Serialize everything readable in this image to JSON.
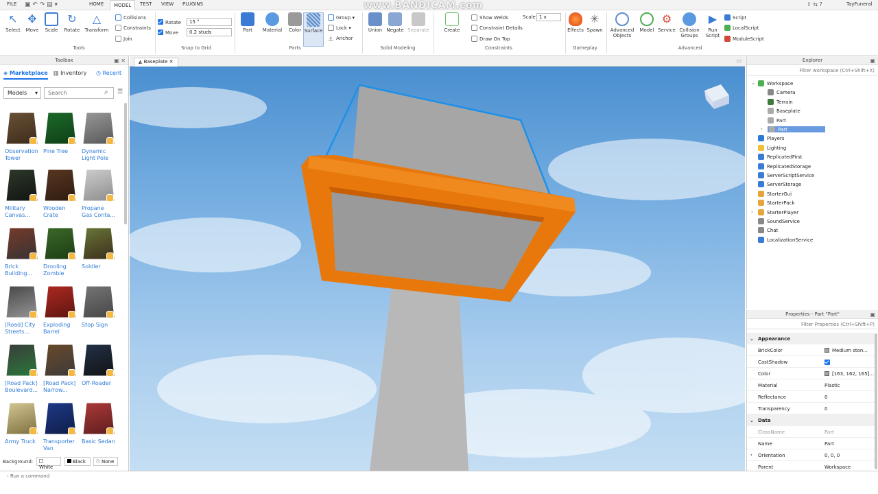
{
  "menubar": {
    "file": "FILE",
    "home": "HOME",
    "model": "MODEL",
    "test": "TEST",
    "view": "VIEW",
    "plugins": "PLUGINS",
    "user": "TayFuneral"
  },
  "watermark": "www.BANDICAM.com",
  "tools": {
    "select": "Select",
    "move": "Move",
    "scale": "Scale",
    "rotate": "Rotate",
    "transform": "Transform",
    "group_label": "Tools",
    "collisions": "Collisions",
    "constraints": "Constraints",
    "join": "Join"
  },
  "snap": {
    "rotate_label": "Rotate",
    "rotate_value": "15 °",
    "move_label": "Move",
    "move_value": "0.2 studs",
    "group_label": "Snap to Grid"
  },
  "parts": {
    "part": "Part",
    "material": "Material",
    "color": "Color",
    "surface": "Surface",
    "group": "Group",
    "lock": "Lock",
    "anchor": "Anchor",
    "group_label": "Parts"
  },
  "solid": {
    "union": "Union",
    "negate": "Negate",
    "separate": "Separate",
    "group_label": "Solid Modeling"
  },
  "constraints": {
    "create": "Create",
    "show_welds": "Show Welds",
    "constraint_details": "Constraint Details",
    "draw_on_top": "Draw On Top",
    "scale_label": "Scale",
    "scale_value": "1 x",
    "group_label": "Constraints"
  },
  "gameplay": {
    "effects": "Effects",
    "spawn": "Spawn",
    "group_label": "Gameplay"
  },
  "advanced": {
    "advanced_objects_1": "Advanced",
    "advanced_objects_2": "Objects",
    "model": "Model",
    "service": "Service",
    "collision_groups_1": "Collision",
    "collision_groups_2": "Groups",
    "run_script_1": "Run",
    "run_script_2": "Script",
    "script": "Script",
    "local_script": "LocalScript",
    "module_script": "ModuleScript",
    "group_label": "Advanced"
  },
  "toolbox": {
    "title": "Toolbox",
    "tab_marketplace": "Marketplace",
    "tab_inventory": "Inventory",
    "tab_recent": "Recent",
    "category": "Models",
    "search_placeholder": "Search",
    "background_label": "Background:",
    "bg_white": "White",
    "bg_black": "Black",
    "bg_none": "None",
    "assets": [
      {
        "l1": "Observation",
        "l2": "Tower"
      },
      {
        "l1": "Pine Tree",
        "l2": ""
      },
      {
        "l1": "Dynamic",
        "l2": "Light Pole"
      },
      {
        "l1": "Military",
        "l2": "Canvas..."
      },
      {
        "l1": "Wooden",
        "l2": "Crate"
      },
      {
        "l1": "Propane",
        "l2": "Gas Conta..."
      },
      {
        "l1": "Brick",
        "l2": "Building..."
      },
      {
        "l1": "Drooling",
        "l2": "Zombie"
      },
      {
        "l1": "Soldier",
        "l2": ""
      },
      {
        "l1": "[Road] City",
        "l2": "Streets..."
      },
      {
        "l1": "Exploding",
        "l2": "Barrel"
      },
      {
        "l1": "Stop Sign",
        "l2": ""
      },
      {
        "l1": "[Road Pack]",
        "l2": "Boulevard..."
      },
      {
        "l1": "[Road Pack]",
        "l2": "Narrow..."
      },
      {
        "l1": "Off-Roader",
        "l2": ""
      },
      {
        "l1": "Army Truck",
        "l2": ""
      },
      {
        "l1": "Transporter",
        "l2": "Van"
      },
      {
        "l1": "Basic Sedan",
        "l2": ""
      }
    ]
  },
  "doc_tab": "Baseplate",
  "explorer": {
    "title": "Explorer",
    "filter_placeholder": "Filter workspace (Ctrl+Shift+X)",
    "items": [
      {
        "label": "Workspace"
      },
      {
        "label": "Camera"
      },
      {
        "label": "Terrain"
      },
      {
        "label": "Baseplate"
      },
      {
        "label": "Part"
      },
      {
        "label": "Part"
      },
      {
        "label": "Players"
      },
      {
        "label": "Lighting"
      },
      {
        "label": "ReplicatedFirst"
      },
      {
        "label": "ReplicatedStorage"
      },
      {
        "label": "ServerScriptService"
      },
      {
        "label": "ServerStorage"
      },
      {
        "label": "StarterGui"
      },
      {
        "label": "StarterPack"
      },
      {
        "label": "StarterPlayer"
      },
      {
        "label": "SoundService"
      },
      {
        "label": "Chat"
      },
      {
        "label": "LocalizationService"
      }
    ]
  },
  "properties": {
    "title": "Properties - Part \"Part\"",
    "filter_placeholder": "Filter Properties (Ctrl+Shift+P)",
    "cat_appearance": "Appearance",
    "cat_data": "Data",
    "rows": [
      {
        "k": "BrickColor",
        "v": "Medium ston..."
      },
      {
        "k": "CastShadow",
        "v": ""
      },
      {
        "k": "Color",
        "v": "[163, 162, 165]..."
      },
      {
        "k": "Material",
        "v": "Plastic"
      },
      {
        "k": "Reflectance",
        "v": "0"
      },
      {
        "k": "Transparency",
        "v": "0"
      }
    ],
    "data_rows": [
      {
        "k": "ClassName",
        "v": "Part"
      },
      {
        "k": "Name",
        "v": "Part"
      },
      {
        "k": "Orientation",
        "v": "0, 0, 0"
      },
      {
        "k": "Parent",
        "v": "Workspace"
      }
    ]
  },
  "command_placeholder": "Run a command",
  "colors": {
    "accent": "#1a73e8",
    "selection": "#4a90e2",
    "frame_orange": "#e8780c"
  }
}
